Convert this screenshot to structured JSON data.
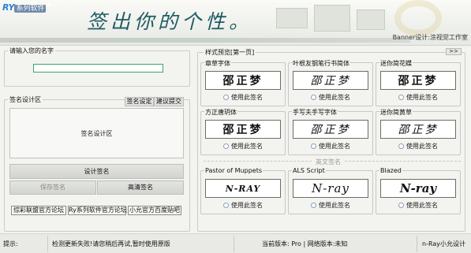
{
  "banner": {
    "logo_mark": "RY",
    "logo_text": "系列软件",
    "logo_reg": "®",
    "slogan": "签出你的个性。",
    "credit": "Banner设计:涂视觉工作室"
  },
  "left": {
    "name_group_title": "请输入您的名字",
    "name_input_value": "",
    "design_group_title": "签名设计区",
    "tab_settings": "签名设定",
    "tab_suggest": "建议提交",
    "design_area_label": "签名设计区",
    "design_button": "设计签名",
    "save_button": "保存签名",
    "hd_button": "高清签名",
    "links": [
      "综彩联盟官方论坛",
      "Ry系列软件官方论坛",
      "小允官方百度贴吧"
    ]
  },
  "right": {
    "group_title": "样式预览[第一页]",
    "expand_label": ">>",
    "use_label": "使用此签名",
    "english_separator": "英文签名",
    "chinese_cards": [
      {
        "title": "章草字体",
        "preview": "邵正梦"
      },
      {
        "title": "叶根友钢笔行书简体",
        "preview": "邵正梦"
      },
      {
        "title": "迷你简花蝶",
        "preview": "邵正梦"
      },
      {
        "title": "方正唐玥体",
        "preview": "邵正梦"
      },
      {
        "title": "手写夫手写字体",
        "preview": "邵正梦"
      },
      {
        "title": "迷你简黄草",
        "preview": "邵正梦"
      }
    ],
    "english_cards": [
      {
        "title": "Pastor of Muppets",
        "preview": "N-RAY"
      },
      {
        "title": "ALS Script",
        "preview": "N-ray"
      },
      {
        "title": "Blazed",
        "preview": "N-ray"
      }
    ]
  },
  "status": {
    "label": "提示:",
    "message": "检测更新失败!请您稍后再试,暂时使用原版",
    "version": "当前版本: Pro | 网络版本:未知",
    "author": "n-Ray小允设计"
  }
}
